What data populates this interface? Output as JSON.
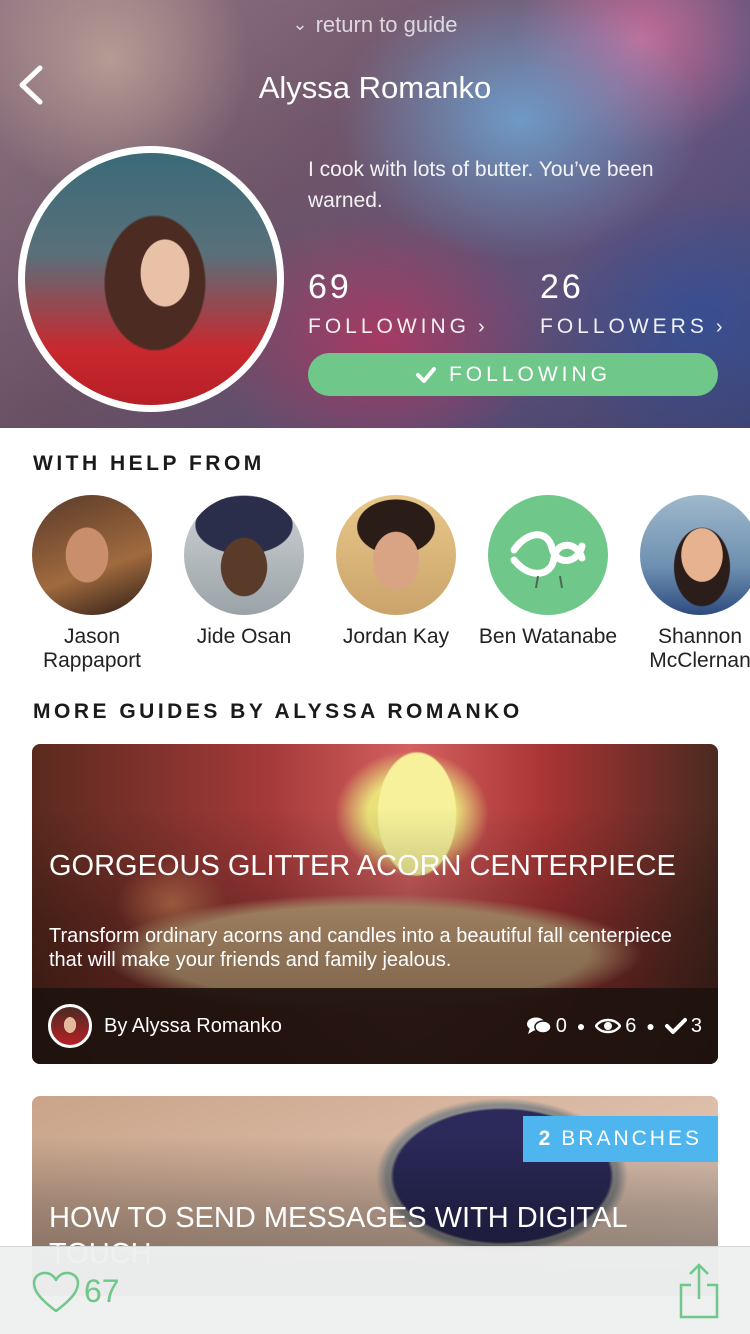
{
  "header": {
    "return_label": "return to guide",
    "profile_name": "Alyssa Romanko",
    "bio": "I cook with lots of butter. You’ve been warned.",
    "following_count": "69",
    "following_label": "FOLLOWING",
    "followers_count": "26",
    "followers_label": "FOLLOWERS",
    "follow_button_label": "FOLLOWING"
  },
  "help_section": {
    "title": "WITH HELP FROM",
    "people": [
      {
        "name": "Jason Rappaport"
      },
      {
        "name": "Jide Osan"
      },
      {
        "name": "Jordan Kay"
      },
      {
        "name": "Ben Watanabe"
      },
      {
        "name": "Shannon McClernan"
      }
    ]
  },
  "guides_section": {
    "title": "MORE GUIDES BY ALYSSA ROMANKO",
    "guides": [
      {
        "title": "GORGEOUS GLITTER ACORN CENTERPIECE",
        "description": "Transform ordinary acorns and candles into a beautiful fall centerpiece that will make your friends and family jealous.",
        "author": "By Alyssa Romanko",
        "comments": "0",
        "views": "6",
        "completed": "3"
      },
      {
        "title": "HOW TO SEND MESSAGES WITH DIGITAL TOUCH",
        "branches_count": "2",
        "branches_label": "BRANCHES"
      }
    ]
  },
  "bottom_bar": {
    "like_count": "67"
  },
  "colors": {
    "accent_green": "#6fc78a",
    "badge_blue": "#4fb5ef"
  }
}
